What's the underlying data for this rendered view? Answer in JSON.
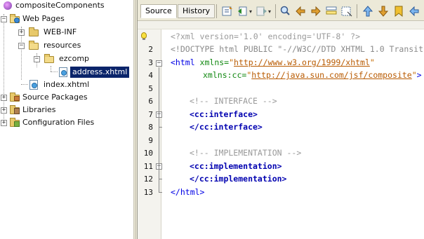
{
  "tree": {
    "project": "compositeComponents",
    "web_pages": "Web Pages",
    "web_inf": "WEB-INF",
    "resources": "resources",
    "ezcomp": "ezcomp",
    "address": "address.xhtml",
    "index": "index.xhtml",
    "source_packages": "Source Packages",
    "libraries": "Libraries",
    "config_files": "Configuration Files"
  },
  "editor": {
    "tabs": [
      "Source",
      "History"
    ],
    "line_numbers": [
      "2",
      "3",
      "4",
      "5",
      "6",
      "7",
      "8",
      "9",
      "10",
      "11",
      "12",
      "13"
    ],
    "code": {
      "l1": "<?xml version='1.0' encoding='UTF-8' ?>",
      "l2": "<!DOCTYPE html PUBLIC \"-//W3C//DTD XHTML 1.0 Transit",
      "l3_tag": "<html",
      "l3_attr": " xmlns=",
      "l3_url": "http://www.w3.org/1999/xhtml",
      "l4_attr": "xmlns:cc=",
      "l4_url": "http://java.sun.com/jsf/composite",
      "l4_end": ">",
      "l6": "<!-- INTERFACE -->",
      "l7": "<cc:interface>",
      "l8": "</cc:interface>",
      "l10": "<!-- IMPLEMENTATION -->",
      "l11": "<cc:implementation>",
      "l12": "</cc:implementation>",
      "l13": "</html>"
    }
  }
}
